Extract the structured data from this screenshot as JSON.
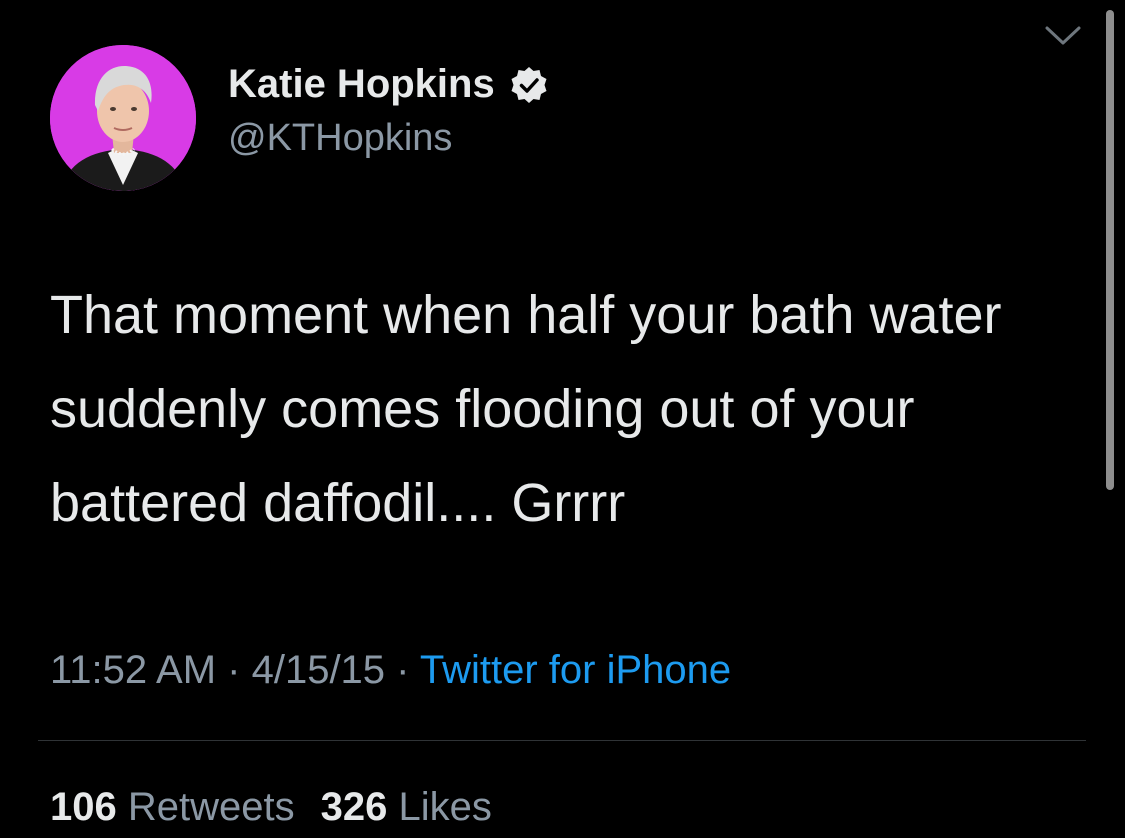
{
  "author": {
    "display_name": "Katie Hopkins",
    "handle": "@KTHopkins",
    "verified": true,
    "avatar_bg_color": "#d83be6"
  },
  "tweet": {
    "text": "That moment when half your bath water suddenly comes flooding out of your battered daffodil.... Grrrr",
    "time": "11:52 AM",
    "separator": " · ",
    "date": "4/15/15",
    "source": "Twitter for iPhone"
  },
  "stats": {
    "retweets_count": "106",
    "retweets_label": "Retweets",
    "likes_count": "326",
    "likes_label": "Likes"
  },
  "icons": {
    "menu": "chevron-down-icon",
    "verified": "verified-badge-icon"
  },
  "colors": {
    "background": "#000000",
    "text": "#e7e9ea",
    "secondary_text": "#8b98a5",
    "link": "#1d9bf0"
  }
}
